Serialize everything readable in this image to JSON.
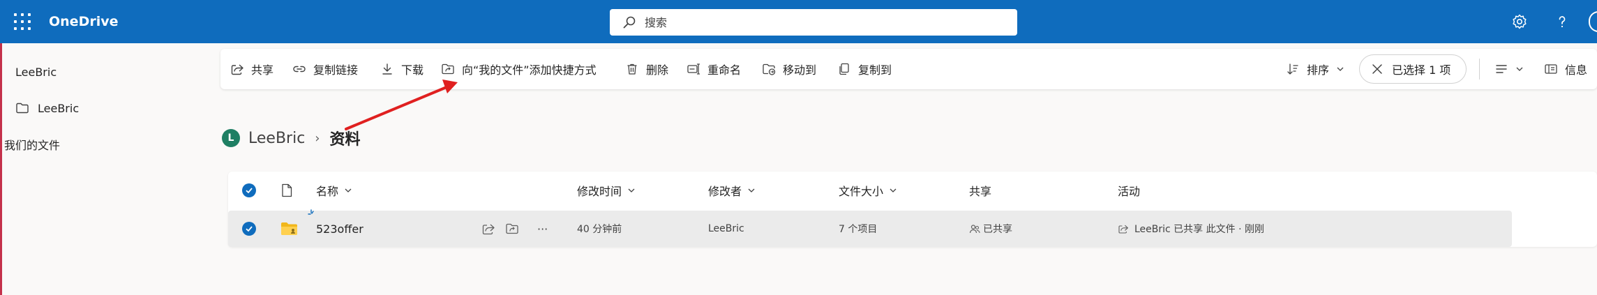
{
  "app": {
    "title": "OneDrive"
  },
  "search": {
    "placeholder": "搜索"
  },
  "sidebar": {
    "user": "LeeBric",
    "items": [
      {
        "label": "LeeBric",
        "icon": "folder-icon"
      }
    ],
    "shared_label": "我们的文件"
  },
  "commands": {
    "share": "共享",
    "copy_link": "复制链接",
    "download": "下载",
    "add_shortcut": "向“我的文件”添加快捷方式",
    "delete": "删除",
    "rename": "重命名",
    "move_to": "移动到",
    "copy_to": "复制到",
    "sort": "排序",
    "selected": "已选择 1 项",
    "info": "信息"
  },
  "breadcrumb": {
    "avatar_letter": "L",
    "root": "LeeBric",
    "current": "资料"
  },
  "list": {
    "columns": {
      "name": "名称",
      "modified": "修改时间",
      "modified_by": "修改者",
      "size": "文件大小",
      "sharing": "共享",
      "activity": "活动"
    },
    "rows": [
      {
        "name": "523offer",
        "modified": "40 分钟前",
        "modified_by": "LeeBric",
        "size": "7 个项目",
        "sharing": "已共享",
        "activity": "LeeBric 已共享 此文件 · 刚刚",
        "more": "···"
      }
    ]
  },
  "colors": {
    "brand": "#0f6cbd",
    "annotation_arrow": "#e02020",
    "avatar": "#1e7f63",
    "folder": "#f2b71b"
  }
}
